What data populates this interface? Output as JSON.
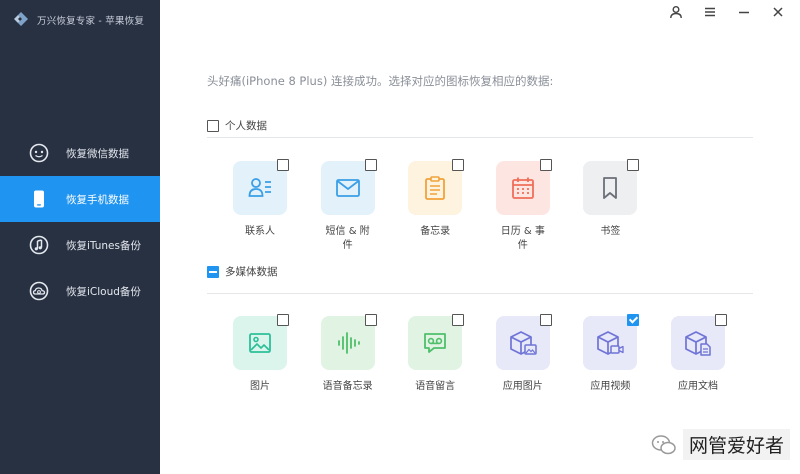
{
  "app": {
    "title": "万兴恢复专家 - 苹果恢复"
  },
  "sidebar": {
    "items": [
      {
        "label": "恢复微信数据",
        "icon": "wechat-icon",
        "active": false
      },
      {
        "label": "恢复手机数据",
        "icon": "phone-icon",
        "active": true
      },
      {
        "label": "恢复iTunes备份",
        "icon": "music-note-icon",
        "active": false
      },
      {
        "label": "恢复iCloud备份",
        "icon": "cloud-restore-icon",
        "active": false
      }
    ]
  },
  "window_controls": [
    "user-icon",
    "menu-icon",
    "minimize-icon",
    "close-icon"
  ],
  "main": {
    "instruction": "头好痛(iPhone 8 Plus) 连接成功。选择对应的图标恢复相应的数据:",
    "sections": [
      {
        "title": "个人数据",
        "state": "unchecked",
        "items": [
          {
            "label": "联系人",
            "icon": "contacts-icon",
            "color": "#3a9fe6",
            "bg": "#e3f1fb",
            "checked": false
          },
          {
            "label": "短信 & 附件",
            "icon": "message-icon",
            "color": "#3a9fe6",
            "bg": "#e3f1fb",
            "checked": false
          },
          {
            "label": "备忘录",
            "icon": "notes-icon",
            "color": "#f0a23a",
            "bg": "#fdf3df",
            "checked": false
          },
          {
            "label": "日历 & 事件",
            "icon": "calendar-icon",
            "color": "#ef6e5a",
            "bg": "#fde6e2",
            "checked": false
          },
          {
            "label": "书签",
            "icon": "bookmark-icon",
            "color": "#6b6f78",
            "bg": "#eeeff1",
            "checked": false
          }
        ]
      },
      {
        "title": "多媒体数据",
        "state": "partial",
        "items": [
          {
            "label": "图片",
            "icon": "image-icon",
            "color": "#2cbf9a",
            "bg": "#dcf5ec",
            "checked": false
          },
          {
            "label": "语音备忘录",
            "icon": "voice-memo-icon",
            "color": "#4fbf6a",
            "bg": "#e1f4e4",
            "checked": false
          },
          {
            "label": "语音留言",
            "icon": "voicemail-icon",
            "color": "#4fbf6a",
            "bg": "#e1f4e4",
            "checked": false
          },
          {
            "label": "应用图片",
            "icon": "app-photo-icon",
            "color": "#6f74d6",
            "bg": "#e7e8f8",
            "checked": false
          },
          {
            "label": "应用视频",
            "icon": "app-video-icon",
            "color": "#6f74d6",
            "bg": "#e7e8f8",
            "checked": true
          },
          {
            "label": "应用文档",
            "icon": "app-document-icon",
            "color": "#6f74d6",
            "bg": "#e7e8f8",
            "checked": false
          }
        ]
      }
    ]
  },
  "watermark": {
    "text": "网管爱好者"
  },
  "colors": {
    "sidebar_bg": "#283142",
    "accent": "#1f94f0"
  }
}
